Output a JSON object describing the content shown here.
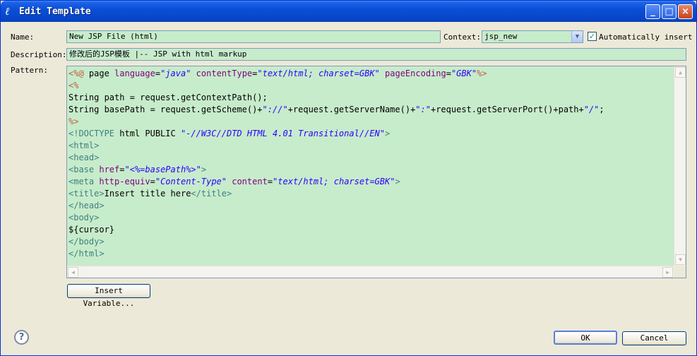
{
  "window": {
    "title": "Edit Template",
    "controls": {
      "minimize": "_",
      "maximize": "□",
      "close": "×"
    }
  },
  "form": {
    "name_label": "Name:",
    "name_value": "New JSP File (html)",
    "context_label": "Context:",
    "context_value": "jsp_new",
    "auto_insert_label": "Automatically insert",
    "auto_insert_checked": true,
    "description_label": "Description:",
    "description_value": "修改后的JSP模板 |-- JSP with html markup",
    "pattern_label": "Pattern:"
  },
  "pattern_lines": [
    "<%@ page language=\"java\" contentType=\"text/html; charset=GBK\" pageEncoding=\"GBK\"%>",
    "<%",
    "String path = request.getContextPath();",
    "String basePath = request.getScheme()+\"://\"+request.getServerName()+\":\"+request.getServerPort()+path+\"/\";",
    "%>",
    "<!DOCTYPE html PUBLIC \"-//W3C//DTD HTML 4.01 Transitional//EN\">",
    "<html>",
    "<head>",
    "<base href=\"<%=basePath%>\">",
    "<meta http-equiv=\"Content-Type\" content=\"text/html; charset=GBK\">",
    "<title>Insert title here</title>",
    "</head>",
    "<body>",
    "${cursor}",
    "</body>",
    "</html>"
  ],
  "buttons": {
    "insert_variable": "Insert Variable...",
    "ok": "OK",
    "cancel": "Cancel",
    "help": "?"
  },
  "colors": {
    "field_bg": "#c7eccb",
    "titlebar": "#0a4fd8",
    "tag": "#3f7f7f",
    "attr": "#7f007f",
    "string": "#2a00ff",
    "directive": "#bf5f3f"
  }
}
